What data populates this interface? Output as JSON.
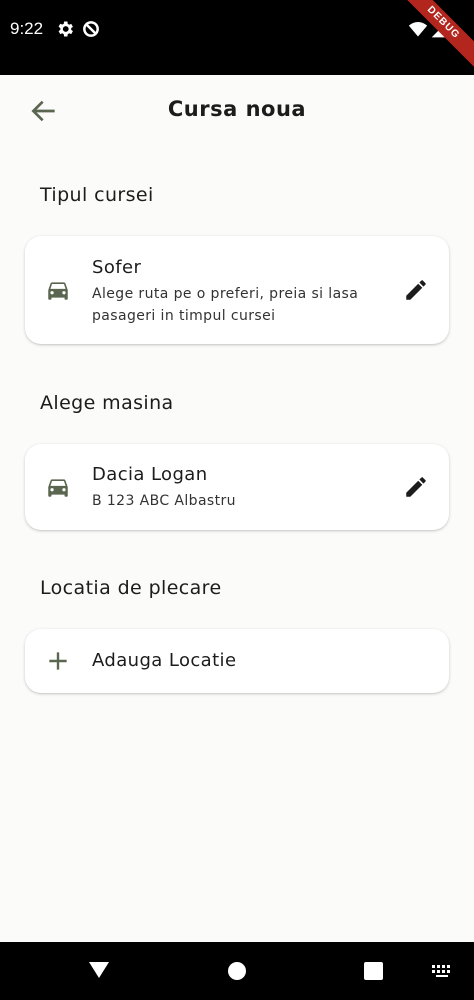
{
  "status_bar": {
    "time": "9:22",
    "debug_label": "DEBUG"
  },
  "app_bar": {
    "title": "Cursa noua"
  },
  "sections": {
    "trip_type": {
      "title": "Tipul cursei",
      "card": {
        "title": "Sofer",
        "subtitle": "Alege ruta pe o preferi, preia si lasa pasageri in timpul cursei"
      }
    },
    "car": {
      "title": "Alege masina",
      "card": {
        "title": "Dacia Logan",
        "subtitle": "B 123 ABC Albastru"
      }
    },
    "departure": {
      "title": "Locatia de plecare",
      "card": {
        "title": "Adauga Locatie"
      }
    }
  },
  "colors": {
    "accent": "#5b6650",
    "background": "#fbfbf9"
  }
}
